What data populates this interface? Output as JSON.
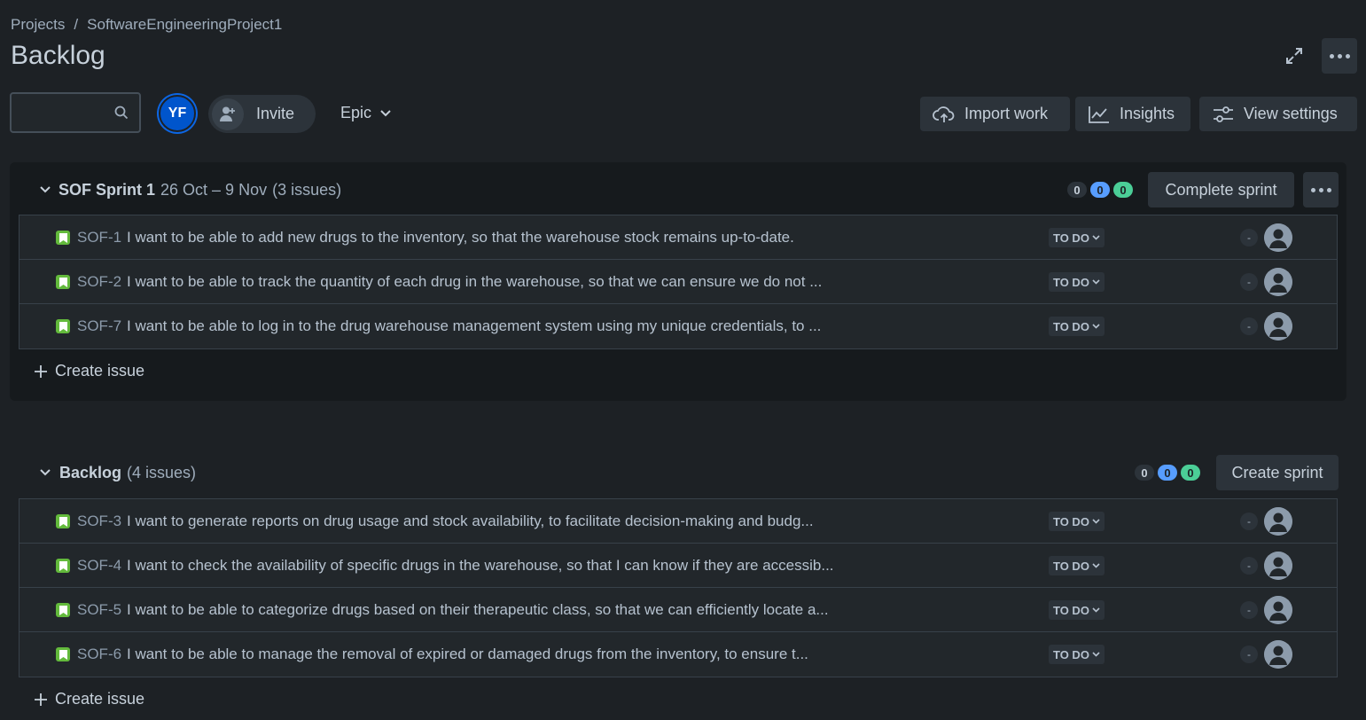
{
  "breadcrumb": {
    "projects": "Projects",
    "separator": "/",
    "project": "SoftwareEngineeringProject1"
  },
  "page_title": "Backlog",
  "toolbar": {
    "avatar_initials": "YF",
    "invite_label": "Invite",
    "epic_label": "Epic",
    "import_label": "Import work",
    "insights_label": "Insights",
    "view_settings_label": "View settings"
  },
  "sprint": {
    "name": "SOF Sprint 1",
    "dates": "26 Oct – 9 Nov",
    "count": "(3 issues)",
    "badges": {
      "todo": "0",
      "in_progress": "0",
      "done": "0"
    },
    "complete_label": "Complete sprint",
    "create_issue_label": "Create issue",
    "issues": [
      {
        "key": "SOF-1",
        "summary": "I want to be able to add new drugs to the inventory, so that the warehouse stock remains up-to-date.",
        "status": "TO DO",
        "estimate": "-"
      },
      {
        "key": "SOF-2",
        "summary": "I want to be able to track the quantity of each drug in the warehouse, so that we can ensure we do not ...",
        "status": "TO DO",
        "estimate": "-"
      },
      {
        "key": "SOF-7",
        "summary": "I want to be able to log in to the drug warehouse management system using my unique credentials, to ...",
        "status": "TO DO",
        "estimate": "-"
      }
    ]
  },
  "backlog": {
    "name": "Backlog",
    "count": "(4 issues)",
    "badges": {
      "todo": "0",
      "in_progress": "0",
      "done": "0"
    },
    "create_sprint_label": "Create sprint",
    "create_issue_label": "Create issue",
    "issues": [
      {
        "key": "SOF-3",
        "summary": "I want to generate reports on drug usage and stock availability, to facilitate decision-making and budg...",
        "status": "TO DO",
        "estimate": "-"
      },
      {
        "key": "SOF-4",
        "summary": "I want to check the availability of specific drugs in the warehouse, so that I can know if they are accessib...",
        "status": "TO DO",
        "estimate": "-"
      },
      {
        "key": "SOF-5",
        "summary": "I want to be able to categorize drugs based on their therapeutic class, so that we can efficiently locate a...",
        "status": "TO DO",
        "estimate": "-"
      },
      {
        "key": "SOF-6",
        "summary": "I want to be able to manage the removal of expired or damaged drugs from the inventory, to ensure t...",
        "status": "TO DO",
        "estimate": "-"
      }
    ]
  },
  "colors": {
    "background": "#1d2125",
    "accent": "#0c66e4",
    "story": "#63ba3c",
    "badge_blue": "#579dff",
    "badge_green": "#4bce97"
  }
}
